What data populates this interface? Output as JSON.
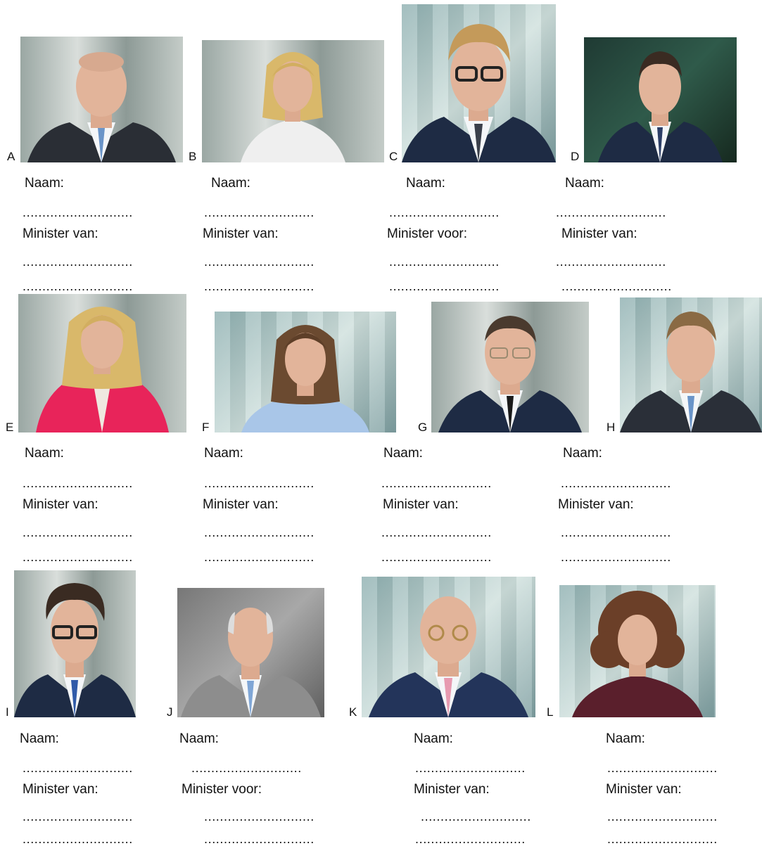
{
  "cards": [
    {
      "letter": "A",
      "naam": "Naam:",
      "minister": "Minister van:",
      "dots": "............................"
    },
    {
      "letter": "B",
      "naam": "Naam:",
      "minister": "Minister van:",
      "dots": "............................"
    },
    {
      "letter": "C",
      "naam": "Naam:",
      "minister": "Minister voor:",
      "dots": "............................"
    },
    {
      "letter": "D",
      "naam": "Naam:",
      "minister": "Minister van:",
      "dots": "............................"
    },
    {
      "letter": "E",
      "naam": "Naam:",
      "minister": "Minister van:",
      "dots": "............................"
    },
    {
      "letter": "F",
      "naam": "Naam:",
      "minister": "Minister van:",
      "dots": "............................"
    },
    {
      "letter": "G",
      "naam": "Naam:",
      "minister": "Minister van:",
      "dots": "............................"
    },
    {
      "letter": "H",
      "naam": "Naam:",
      "minister": "Minister van:",
      "dots": "............................"
    },
    {
      "letter": "I",
      "naam": "Naam:",
      "minister": "Minister van:",
      "dots": "............................"
    },
    {
      "letter": "J",
      "naam": "Naam:",
      "minister": "Minister voor:",
      "dots": "............................"
    },
    {
      "letter": "K",
      "naam": "Naam:",
      "minister": "Minister van:",
      "dots": "............................"
    },
    {
      "letter": "L",
      "naam": "Naam:",
      "minister": "Minister van:",
      "dots": "............................"
    }
  ],
  "colors": {
    "suit_dark": "#1e2b44",
    "suit_grey": "#8d8d8d",
    "blazer_pink": "#e8245a",
    "top_white": "#efefef",
    "top_lightblue": "#a9c6e8",
    "top_maroon": "#5a1f2c",
    "skin": "#e2b49a",
    "hair_blonde": "#d9b86a",
    "hair_brown": "#6b4a30",
    "hair_dark": "#3a2b22"
  }
}
